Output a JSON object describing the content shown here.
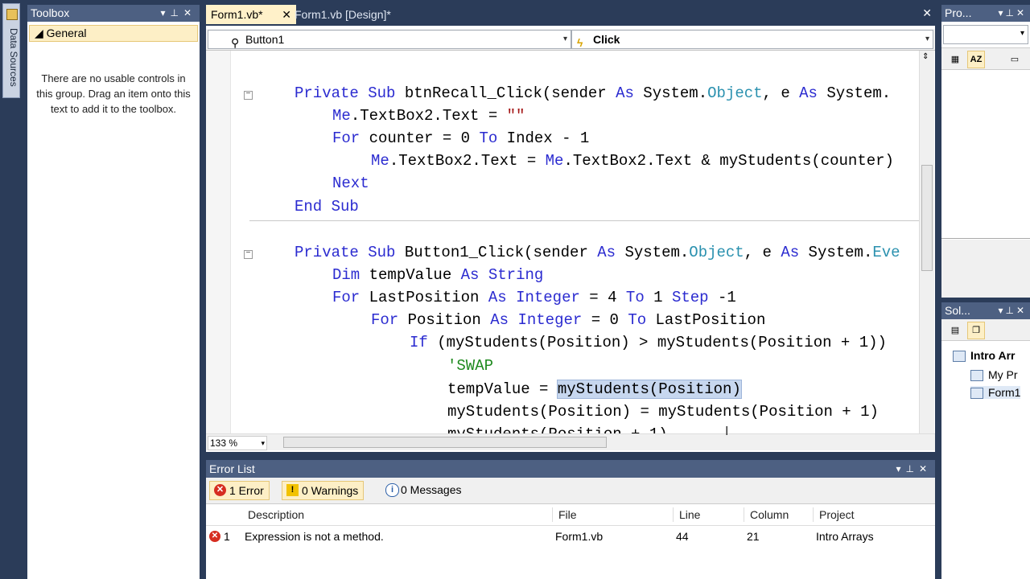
{
  "left_strip": {
    "tab_label": "Data Sources"
  },
  "toolbox": {
    "title": "Toolbox",
    "group": "General",
    "empty_message": "There are no usable controls in this group. Drag an item onto this text to add it to the toolbox."
  },
  "tabs": [
    {
      "label": "Form1.vb*",
      "active": true
    },
    {
      "label": "Form1.vb [Design]*",
      "active": false
    }
  ],
  "editor": {
    "object_combo": "Button1",
    "event_combo": "Click",
    "zoom": "133 %"
  },
  "code_lines": [
    {
      "id": "l1",
      "text": "Private Sub btnRecall_Click(sender As System.Object, e As System."
    },
    {
      "id": "l2",
      "text": "Me.TextBox2.Text = \"\""
    },
    {
      "id": "l3",
      "text": "For counter = 0 To Index - 1"
    },
    {
      "id": "l4",
      "text": "Me.TextBox2.Text = Me.TextBox2.Text & myStudents(counter)"
    },
    {
      "id": "l5",
      "text": "Next"
    },
    {
      "id": "l6",
      "text": "End Sub"
    },
    {
      "id": "l7",
      "text": "Private Sub Button1_Click(sender As System.Object, e As System.Eve"
    },
    {
      "id": "l8",
      "text": "Dim tempValue As String"
    },
    {
      "id": "l9",
      "text": "For LastPosition As Integer = 4 To 1 Step -1"
    },
    {
      "id": "l10",
      "text": "For Position As Integer = 0 To LastPosition"
    },
    {
      "id": "l11",
      "text": "If (myStudents(Position) > myStudents(Position + 1))"
    },
    {
      "id": "l12",
      "text": "'SWAP"
    },
    {
      "id": "l13",
      "text": "tempValue = myStudents(Position)"
    },
    {
      "id": "l14",
      "text": "myStudents(Position) = myStudents(Position + 1)"
    },
    {
      "id": "l15",
      "text": "myStudents(Position + 1)"
    }
  ],
  "error_list": {
    "title": "Error List",
    "filters": {
      "errors": "1 Error",
      "warnings": "0 Warnings",
      "messages": "0 Messages"
    },
    "columns": {
      "description": "Description",
      "file": "File",
      "line": "Line",
      "column": "Column",
      "project": "Project"
    },
    "rows": [
      {
        "index": "1",
        "description": "Expression is not a method.",
        "file": "Form1.vb",
        "line": "44",
        "column": "21",
        "project": "Intro Arrays"
      }
    ]
  },
  "properties": {
    "title": "Pro..."
  },
  "solution": {
    "title": "Sol...",
    "items": [
      "Intro Arr",
      "My Pr",
      "Form1"
    ]
  },
  "colors": {
    "keyword": "#2b2bd0",
    "type": "#2b91af",
    "string": "#a31515",
    "comment": "#1f8a1f",
    "chrome": "#2b3c59",
    "active_tab": "#fff1c9"
  }
}
